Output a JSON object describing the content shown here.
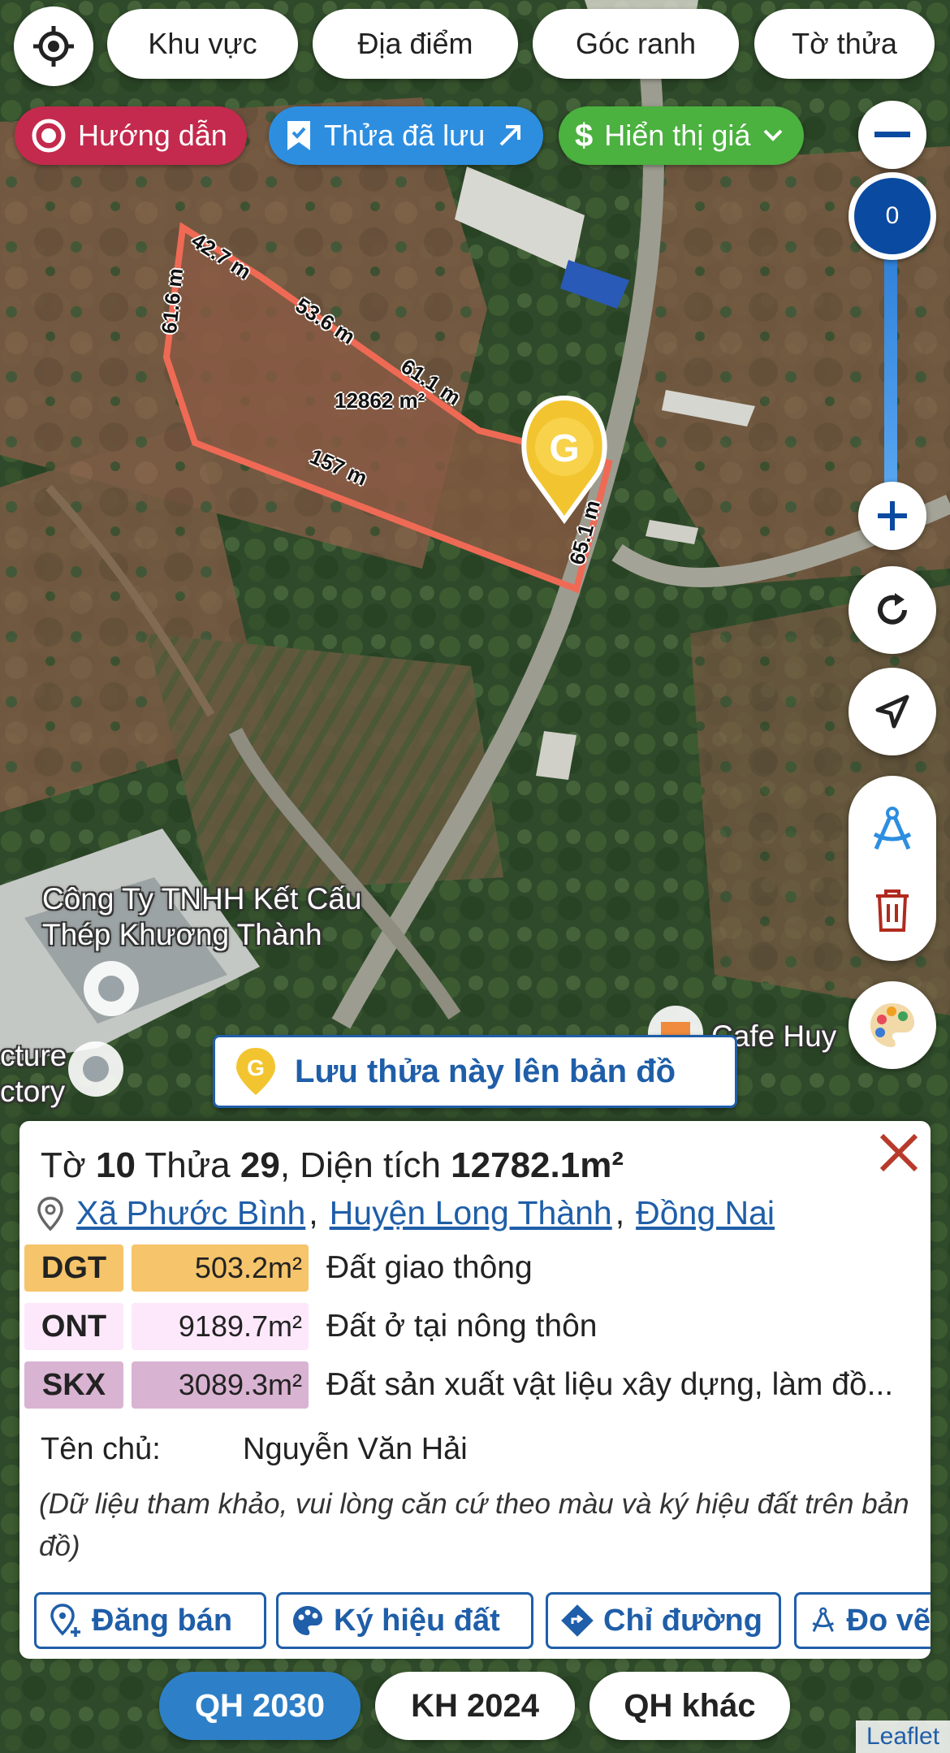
{
  "top_chips": [
    {
      "label": "Khu vực"
    },
    {
      "label": "Địa điểm"
    },
    {
      "label": "Góc ranh"
    },
    {
      "label": "Tờ thửa"
    }
  ],
  "pills": {
    "guide": "Hướng dẫn",
    "saved": "Thửa đã lưu",
    "price": "Hiển thị giá"
  },
  "colors": {
    "guide": "#c42a4d",
    "saved": "#2d8ee0",
    "price": "#4bb13f",
    "brand": "#1f5ea8"
  },
  "zoom": {
    "value": "0"
  },
  "map": {
    "parcel_area": "12862 m²",
    "edges": [
      "42.7 m",
      "53.6 m",
      "61.1 m",
      "157 m",
      "65.1 m",
      "61.6 m"
    ],
    "poi_1": "Công Ty TNHH Kết Cấu Thép Khương Thành",
    "poi_2": "cture",
    "poi_3": "ctory",
    "poi_4": "Cafe Huy"
  },
  "save_banner": "Lưu thửa này lên bản đồ",
  "info": {
    "title_prefix": "Tờ",
    "sheet": "10",
    "plot_prefix": "Thửa",
    "plot": "29",
    "area_prefix": ", Diện tích",
    "area": "12782.1m²",
    "address": [
      "Xã Phước Bình",
      "Huyện Long Thành",
      "Đồng Nai"
    ],
    "land_uses": [
      {
        "code": "DGT",
        "area": "503.2m²",
        "desc": "Đất giao thông",
        "color": "#f6c46a",
        "area_color": "#f6c46a"
      },
      {
        "code": "ONT",
        "area": "9189.7m²",
        "desc": "Đất ở tại nông thôn",
        "color": "#fde8fb",
        "area_color": "#fde8fb"
      },
      {
        "code": "SKX",
        "area": "3089.3m²",
        "desc": "Đất sản xuất vật liệu xây dựng, làm đồ...",
        "color": "#d9b3d2",
        "area_color": "#d9b3d2"
      }
    ],
    "owner_label": "Tên chủ:",
    "owner_name": "Nguyễn Văn Hải",
    "note": "(Dữ liệu tham khảo, vui lòng căn cứ theo màu và ký hiệu đất trên bản đồ)",
    "actions": [
      "Đăng bán",
      "Ký hiệu đất",
      "Chỉ đường",
      "Đo vẽ"
    ]
  },
  "tabs": [
    {
      "label": "QH 2030",
      "active": true
    },
    {
      "label": "KH 2024",
      "active": false
    },
    {
      "label": "QH khác",
      "active": false
    }
  ],
  "attribution": "Leaflet"
}
